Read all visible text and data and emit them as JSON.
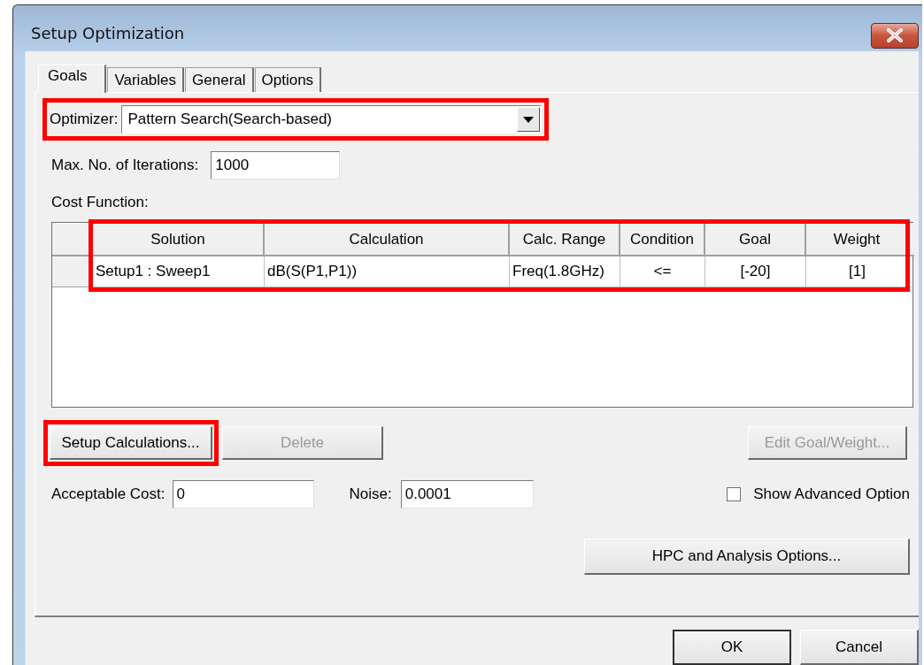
{
  "window": {
    "title": "Setup Optimization"
  },
  "tabs": [
    {
      "label": "Goals",
      "selected": true
    },
    {
      "label": "Variables",
      "selected": false
    },
    {
      "label": "General",
      "selected": false
    },
    {
      "label": "Options",
      "selected": false
    }
  ],
  "optimizer": {
    "label": "Optimizer:",
    "value": "Pattern Search(Search-based)",
    "highlighted": true
  },
  "max_iterations": {
    "label": "Max. No. of Iterations:",
    "value": "1000"
  },
  "cost_function": {
    "label": "Cost Function:",
    "highlighted": true,
    "columns": [
      "Solution",
      "Calculation",
      "Calc. Range",
      "Condition",
      "Goal",
      "Weight"
    ],
    "rows": [
      [
        "Setup1 : Sweep1",
        "dB(S(P1,P1))",
        "Freq(1.8GHz)",
        "<=",
        "[-20]",
        "[1]"
      ]
    ]
  },
  "buttons": [
    {
      "label": "Setup Calculations...",
      "disabled": false,
      "highlighted": true
    },
    {
      "label": "Delete",
      "disabled": true,
      "highlighted": false
    },
    {
      "label": "Edit Goal/Weight...",
      "disabled": true,
      "highlighted": false
    }
  ],
  "acceptable_cost": {
    "label": "Acceptable Cost:",
    "value": "0"
  },
  "noise": {
    "label": "Noise:",
    "value": "0.0001"
  },
  "show_advanced": {
    "label": "Show Advanced Option",
    "checked": false
  },
  "hpc_button": {
    "label": "HPC and Analysis Options..."
  },
  "dialog_buttons": [
    "OK",
    "Cancel"
  ]
}
